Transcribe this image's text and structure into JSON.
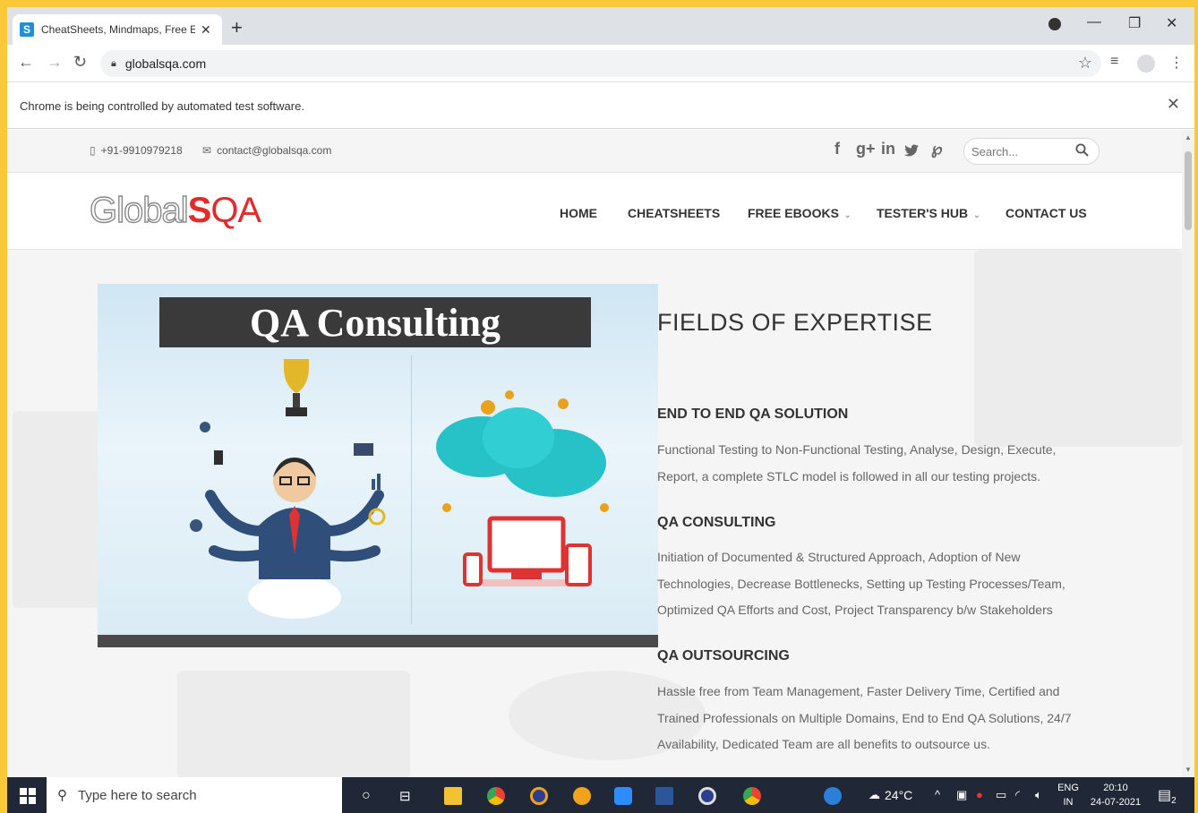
{
  "browser": {
    "tab_title": "CheatSheets, Mindmaps, Free Eb",
    "tab_favicon": "S",
    "tab_close": "✕",
    "new_tab": "+",
    "url": "globalsqa.com",
    "infobar_text": "Chrome is being controlled by automated test software.",
    "infobar_close": "✕"
  },
  "topbar": {
    "phone": "+91-9910979218",
    "email": "contact@globalsqa.com",
    "social": [
      "f",
      "g+",
      "in",
      "twitter",
      "p"
    ],
    "search_placeholder": "Search..."
  },
  "header": {
    "logo_global": "Global",
    "logo_s": "S",
    "logo_qa": "QA",
    "nav": {
      "home": "HOME",
      "cheatsheets": "CHEATSHEETS",
      "free_ebooks": "FREE EBOOKS",
      "testers_hub": "TESTER'S HUB",
      "contact_us": "CONTACT US"
    }
  },
  "hero": {
    "banner_title": "QA Consulting"
  },
  "expertise": {
    "heading": "FIELDS OF EXPERTISE",
    "items": [
      {
        "title": "END TO END QA SOLUTION",
        "text": "Functional Testing to Non-Functional Testing, Analyse, Design, Execute, Report, a complete STLC model is followed in all our testing projects."
      },
      {
        "title": "QA CONSULTING",
        "text": "Initiation of Documented & Structured Approach, Adoption of New Technologies, Decrease Bottlenecks, Setting up Testing Processes/Team, Optimized QA Efforts and Cost, Project Transparency b/w Stakeholders"
      },
      {
        "title": "QA OUTSOURCING",
        "text": "Hassle free from Team Management, Faster Delivery Time, Certified and Trained Professionals on Multiple Domains, End to End QA Solutions, 24/7 Availability, Dedicated Team are all benefits to outsource us."
      }
    ]
  },
  "taskbar": {
    "search_text": "Type here to search",
    "weather": "24°C",
    "lang_top": "ENG",
    "lang_bottom": "IN",
    "time": "20:10",
    "date": "24-07-2021",
    "notif_count": "2"
  },
  "colors": {
    "accent_red": "#e32b2b",
    "frame_yellow": "#f9c93a",
    "taskbar": "#202736"
  }
}
